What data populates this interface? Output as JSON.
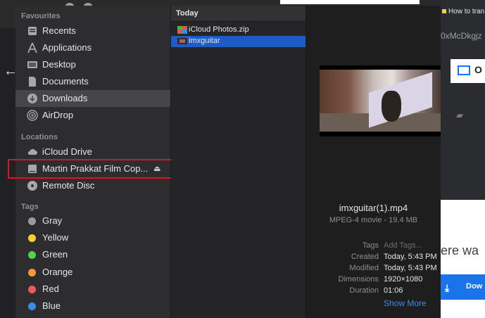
{
  "background": {
    "tab_link": "How to tran",
    "url_fragment": "0xMcDkgjz",
    "card_letter": "O",
    "promo_text": "ere wa",
    "download_label": "Dow"
  },
  "sidebar": {
    "favourites_header": "Favourites",
    "favourites": [
      {
        "label": "Recents",
        "icon": "clock-icon"
      },
      {
        "label": "Applications",
        "icon": "applications-icon"
      },
      {
        "label": "Desktop",
        "icon": "desktop-icon"
      },
      {
        "label": "Documents",
        "icon": "document-icon"
      },
      {
        "label": "Downloads",
        "icon": "downloads-icon",
        "selected": true
      },
      {
        "label": "AirDrop",
        "icon": "airdrop-icon"
      }
    ],
    "locations_header": "Locations",
    "locations": [
      {
        "label": "iCloud Drive",
        "icon": "cloud-icon"
      },
      {
        "label": "Martin Prakkat Film Cop...",
        "icon": "drive-icon",
        "eject": "⏏"
      },
      {
        "label": "Remote Disc",
        "icon": "disc-icon"
      }
    ],
    "tags_header": "Tags",
    "tags": [
      {
        "label": "Gray",
        "color": "#9b9b9b"
      },
      {
        "label": "Yellow",
        "color": "#f7cf30"
      },
      {
        "label": "Green",
        "color": "#52d34e"
      },
      {
        "label": "Orange",
        "color": "#f39a3b"
      },
      {
        "label": "Red",
        "color": "#ec5b57"
      },
      {
        "label": "Blue",
        "color": "#3b8beb"
      }
    ]
  },
  "file_column": {
    "header": "Today",
    "files": [
      {
        "name": "iCloud Photos.zip",
        "icon": "zip-icon"
      },
      {
        "name": "imxguitar",
        "icon": "video-icon",
        "selected": true
      }
    ]
  },
  "preview": {
    "file_name": "imxguitar(1).mp4",
    "kind": "MPEG-4 movie - 19.4 MB",
    "meta": [
      {
        "key": "Tags",
        "value": "Add Tags...",
        "placeholder": true
      },
      {
        "key": "Created",
        "value": "Today, 5:43 PM"
      },
      {
        "key": "Modified",
        "value": "Today, 5:43 PM"
      },
      {
        "key": "Dimensions",
        "value": "1920×1080"
      },
      {
        "key": "Duration",
        "value": "01:06"
      }
    ],
    "show_more": "Show More"
  },
  "colors": {
    "selection": "#1e5bc6",
    "accent": "#3b8beb",
    "annotation_box": "#e0141e"
  }
}
